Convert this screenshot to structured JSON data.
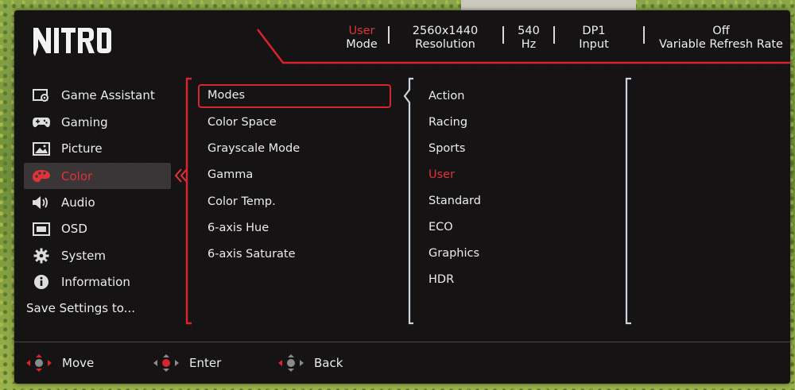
{
  "brand": "NITRO",
  "status_bar": [
    {
      "value": "User",
      "label": "Mode"
    },
    {
      "value": "2560x1440",
      "label": "Resolution"
    },
    {
      "value": "540",
      "label": "Hz"
    },
    {
      "value": "DP1",
      "label": "Input"
    },
    {
      "value": "Off",
      "label": "Variable Refresh Rate"
    }
  ],
  "menu": [
    {
      "label": "Game Assistant",
      "icon": "game-assistant-icon"
    },
    {
      "label": "Gaming",
      "icon": "gamepad-icon"
    },
    {
      "label": "Picture",
      "icon": "picture-icon"
    },
    {
      "label": "Color",
      "icon": "color-icon",
      "active": true
    },
    {
      "label": "Audio",
      "icon": "speaker-icon"
    },
    {
      "label": "OSD",
      "icon": "osd-icon"
    },
    {
      "label": "System",
      "icon": "gear-icon"
    },
    {
      "label": "Information",
      "icon": "info-icon"
    }
  ],
  "save_settings": "Save Settings to...",
  "submenu": [
    "Modes",
    "Color Space",
    "Grayscale Mode",
    "Gamma",
    "Color Temp.",
    "6-axis Hue",
    "6-axis Saturate"
  ],
  "options": [
    "Action",
    "Racing",
    "Sports",
    "User",
    "Standard",
    "ECO",
    "Graphics",
    "HDR"
  ],
  "selected_option": "User",
  "footer": {
    "move": "Move",
    "enter": "Enter",
    "back": "Back"
  },
  "colors": {
    "accent": "#e2323a",
    "panel": "#141213",
    "highlight": "#3a3536"
  }
}
